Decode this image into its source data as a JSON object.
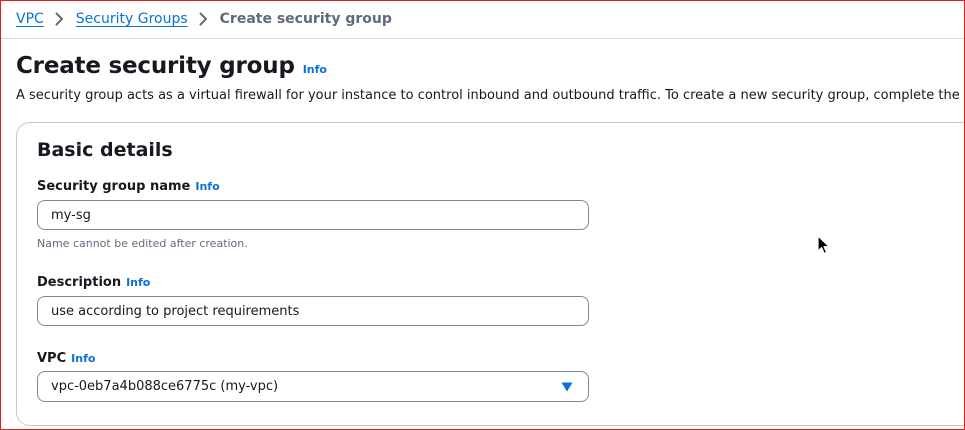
{
  "breadcrumb": {
    "items": [
      {
        "label": "VPC"
      },
      {
        "label": "Security Groups"
      }
    ],
    "current": "Create security group"
  },
  "header": {
    "title": "Create security group",
    "info_label": "Info",
    "description": "A security group acts as a virtual firewall for your instance to control inbound and outbound traffic. To create a new security group, complete the fields below."
  },
  "basic_details": {
    "title": "Basic details",
    "name_field": {
      "label": "Security group name",
      "info_label": "Info",
      "value": "my-sg",
      "constraint": "Name cannot be edited after creation."
    },
    "description_field": {
      "label": "Description",
      "info_label": "Info",
      "value": "use according to project requirements"
    },
    "vpc_field": {
      "label": "VPC",
      "info_label": "Info",
      "selected": "vpc-0eb7a4b088ce6775c (my-vpc)"
    }
  },
  "colors": {
    "link": "#0972d3",
    "text": "#16191f",
    "secondary_text": "#5f6b7a",
    "input_border": "#7d8998",
    "frame_border": "#e02020"
  },
  "icons": {
    "breadcrumb_separator": "chevron-right-icon",
    "select_caret": "caret-down-icon",
    "mouse": "mouse-pointer-icon"
  }
}
